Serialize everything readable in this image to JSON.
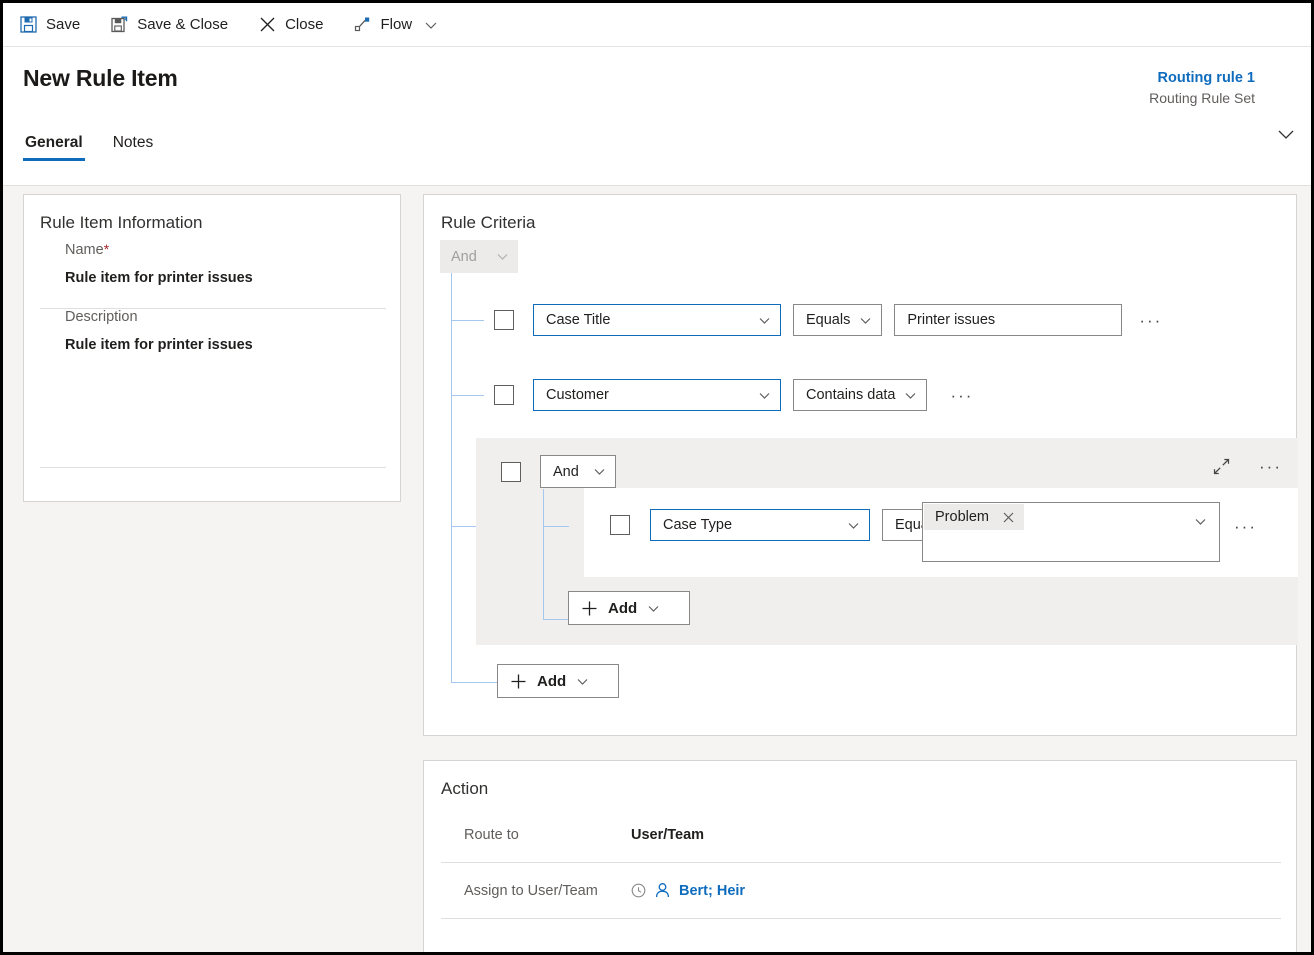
{
  "commandbar": {
    "items": [
      {
        "label": "Save",
        "icon": "save-icon"
      },
      {
        "label": "Save & Close",
        "icon": "save-and-close-icon"
      },
      {
        "label": "Close",
        "icon": "close-x-icon"
      },
      {
        "label": "Flow",
        "icon": "flow-icon"
      }
    ],
    "overflow_chevron": "chevron-down-icon"
  },
  "header": {
    "title": "New Rule Item",
    "context": {
      "name": "Routing rule 1",
      "subtitle": "Routing Rule Set",
      "expand_icon": "chevron-down-icon"
    },
    "tabs": [
      {
        "label": "General",
        "active": true
      },
      {
        "label": "Notes",
        "active": false
      }
    ]
  },
  "info_card": {
    "title": "Rule Item Information",
    "fields": [
      {
        "label": "Name",
        "required": true,
        "required_marker": "*",
        "value": "Rule item for printer issues"
      },
      {
        "label": "Description",
        "required": false,
        "required_marker": "",
        "value": "Rule item for printer issues"
      }
    ]
  },
  "criteria_card": {
    "title": "Rule Criteria",
    "root_operator": {
      "label": "And",
      "chevron": "chevron-down-icon",
      "disabled": true
    },
    "rows": [
      {
        "attribute": "Case Title",
        "operator": "Equals",
        "value": "Printer issues",
        "more_label": "···"
      },
      {
        "attribute": "Customer",
        "operator": "Contains data",
        "value": "",
        "more_label": "···"
      }
    ],
    "group": {
      "operator": {
        "label": "And",
        "chevron": "chevron-down-icon"
      },
      "collapse_icon": "collapse-diagonal-icon",
      "more_label": "···",
      "rows": [
        {
          "attribute": "Case Type",
          "operator": "Equals",
          "tag": "Problem",
          "tag_remove_icon": "close-x-icon",
          "more_label": "···"
        }
      ],
      "add_button": {
        "label": "Add",
        "plus_icon": "plus-icon",
        "chevron": "chevron-down-icon"
      }
    },
    "add_button": {
      "label": "Add",
      "plus_icon": "plus-icon",
      "chevron": "chevron-down-icon"
    }
  },
  "action_card": {
    "title": "Action",
    "rows": [
      {
        "label": "Route to",
        "value": "User/Team",
        "type": "text"
      },
      {
        "label": "Assign to User/Team",
        "value": "Bert; Heir",
        "type": "lookup",
        "recent_icon": "recent-clock-icon",
        "entity_icon": "user-icon"
      }
    ]
  },
  "colors": {
    "accent": "#0f6cbd",
    "tree_line": "#a6c8f0",
    "required": "#a4262c",
    "page_background": "#f5f4f2",
    "group_background": "#f0efee"
  }
}
